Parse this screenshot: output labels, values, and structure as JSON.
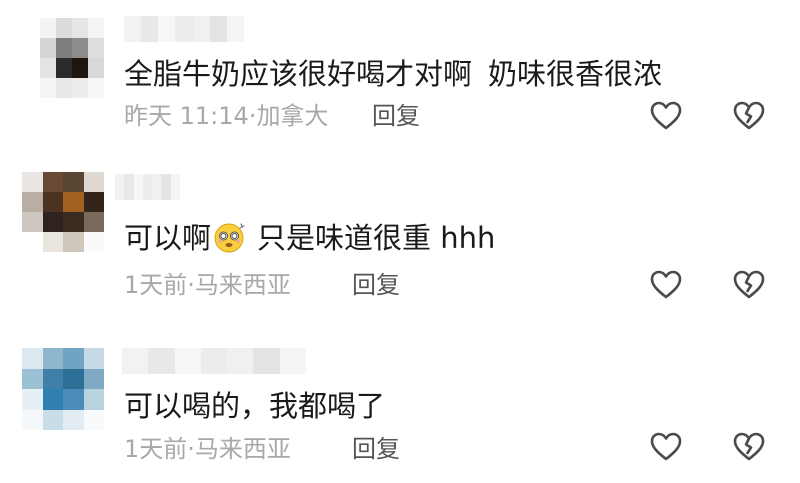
{
  "comments": [
    {
      "text_parts": [
        "全脂牛奶应该很好喝才对啊",
        "奶味很香很浓"
      ],
      "time": "昨天 11:14",
      "location": "加拿大",
      "reply_label": "回复",
      "like_icon": "heart-outline-icon",
      "dislike_icon": "broken-heart-icon",
      "avatar_colors": [
        "#f3f3f3",
        "#dcdcdc",
        "#e6e6e6",
        "#f5f5f5",
        "#d6d6d6",
        "#7d7d7d",
        "#8c8c8c",
        "#dedede",
        "#e3e3e3",
        "#2b2b2b",
        "#1e1410",
        "#d9d9d9",
        "#f4f4f4",
        "#e9e9e9",
        "#ececec",
        "#f7f7f7"
      ]
    },
    {
      "text_before": "可以啊",
      "text_after": "只是味道很重 hhh",
      "emoji_icon": "dizzy-smiley-emoji-icon",
      "time": "1天前",
      "location": "马来西亚",
      "reply_label": "回复",
      "like_icon": "heart-outline-icon",
      "dislike_icon": "broken-heart-icon",
      "avatar_colors": [
        "#e9e6e3",
        "#6b4a34",
        "#5a4533",
        "#ded8d1",
        "#b8aea3",
        "#4b3322",
        "#a45f23",
        "#322418",
        "#cfc8c0",
        "#2e241d",
        "#3a2c21",
        "#7a6a5c",
        "#ffffff",
        "#e9e4de",
        "#cfc6bc",
        "#fafafa"
      ]
    },
    {
      "text_parts": [
        "可以喝的，我都喝了"
      ],
      "time": "1天前",
      "location": "马来西亚",
      "reply_label": "回复",
      "like_icon": "heart-outline-icon",
      "dislike_icon": "broken-heart-icon",
      "avatar_colors": [
        "#dce8ef",
        "#8fb6cc",
        "#6fa4c2",
        "#c6dae6",
        "#9cc0d4",
        "#3f7fa8",
        "#2e6f98",
        "#7fa9c3",
        "#e6eff4",
        "#2f7fb3",
        "#4a8dba",
        "#b8d2e0",
        "#f5f8fa",
        "#c9dde8",
        "#e2ecf2",
        "#f8fafb"
      ]
    }
  ],
  "username_blur_colors": [
    "#f2f2f2",
    "#e8e8e8",
    "#f6f6f6",
    "#ececec",
    "#f0f0f0",
    "#e4e4e4",
    "#f5f5f5"
  ],
  "colors": {
    "text": "#1a1a1a",
    "meta": "#a8a8a8",
    "reply": "#545454",
    "icon": "#4a4a4a"
  }
}
